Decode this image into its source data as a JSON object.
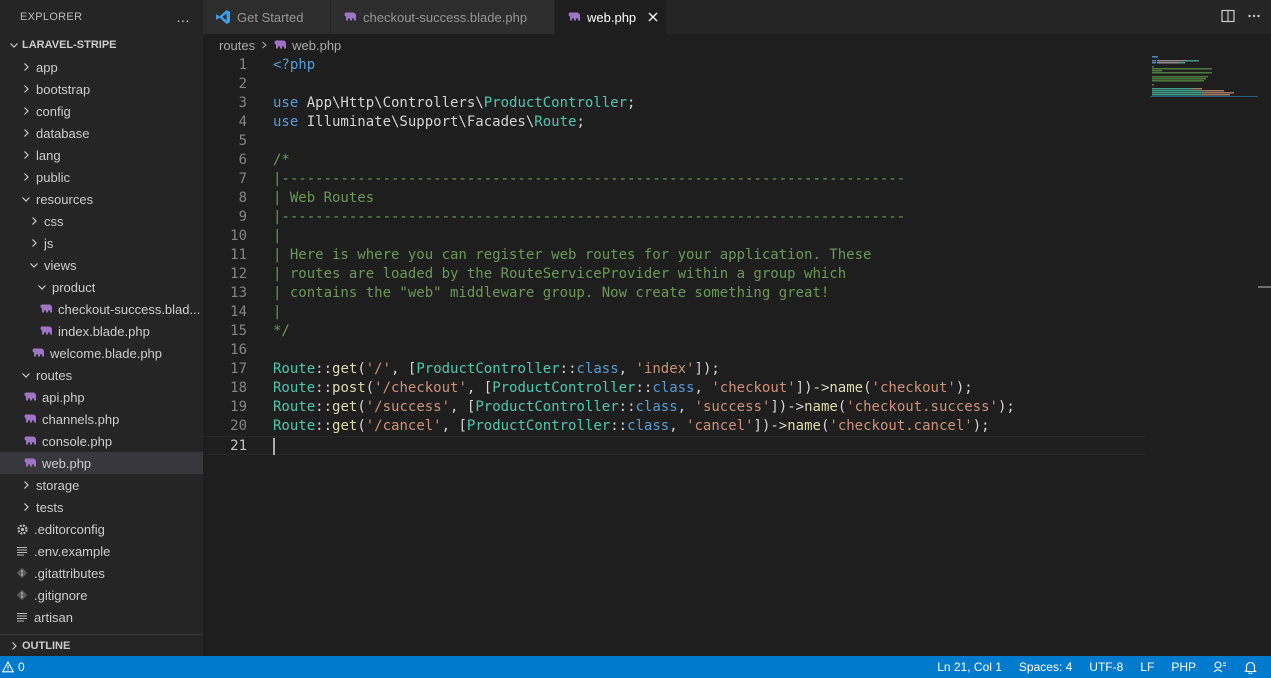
{
  "sidebar": {
    "title": "EXPLORER",
    "more_icon": "…",
    "project": "LARAVEL-STRIPE",
    "items": [
      {
        "label": "app",
        "level": 0,
        "type": "folder",
        "state": "collapsed"
      },
      {
        "label": "bootstrap",
        "level": 0,
        "type": "folder",
        "state": "collapsed"
      },
      {
        "label": "config",
        "level": 0,
        "type": "folder",
        "state": "collapsed"
      },
      {
        "label": "database",
        "level": 0,
        "type": "folder",
        "state": "collapsed"
      },
      {
        "label": "lang",
        "level": 0,
        "type": "folder",
        "state": "collapsed"
      },
      {
        "label": "public",
        "level": 0,
        "type": "folder",
        "state": "collapsed"
      },
      {
        "label": "resources",
        "level": 0,
        "type": "folder",
        "state": "expanded"
      },
      {
        "label": "css",
        "level": 1,
        "type": "folder",
        "state": "collapsed"
      },
      {
        "label": "js",
        "level": 1,
        "type": "folder",
        "state": "collapsed"
      },
      {
        "label": "views",
        "level": 1,
        "type": "folder",
        "state": "expanded"
      },
      {
        "label": "product",
        "level": 2,
        "type": "folder",
        "state": "expanded"
      },
      {
        "label": "checkout-success.blad...",
        "level": 3,
        "type": "php"
      },
      {
        "label": "index.blade.php",
        "level": 3,
        "type": "php"
      },
      {
        "label": "welcome.blade.php",
        "level": 2,
        "type": "php"
      },
      {
        "label": "routes",
        "level": 0,
        "type": "folder",
        "state": "expanded"
      },
      {
        "label": "api.php",
        "level": 1,
        "type": "php"
      },
      {
        "label": "channels.php",
        "level": 1,
        "type": "php"
      },
      {
        "label": "console.php",
        "level": 1,
        "type": "php"
      },
      {
        "label": "web.php",
        "level": 1,
        "type": "php",
        "selected": true
      },
      {
        "label": "storage",
        "level": 0,
        "type": "folder",
        "state": "collapsed"
      },
      {
        "label": "tests",
        "level": 0,
        "type": "folder",
        "state": "collapsed"
      },
      {
        "label": ".editorconfig",
        "level": 0,
        "type": "gear"
      },
      {
        "label": ".env.example",
        "level": 0,
        "type": "lines"
      },
      {
        "label": ".gitattributes",
        "level": 0,
        "type": "git"
      },
      {
        "label": ".gitignore",
        "level": 0,
        "type": "git"
      },
      {
        "label": "artisan",
        "level": 0,
        "type": "lines"
      }
    ],
    "outline": "OUTLINE"
  },
  "tabs": [
    {
      "label": "Get Started",
      "icon": "vscode-icon",
      "active": false
    },
    {
      "label": "checkout-success.blade.php",
      "icon": "php-icon",
      "active": false
    },
    {
      "label": "web.php",
      "icon": "php-icon",
      "active": true
    }
  ],
  "breadcrumb": {
    "folder": "routes",
    "file": "web.php"
  },
  "editor": {
    "current_line": 21,
    "lines": [
      [
        [
          "<?php",
          "kw"
        ]
      ],
      [],
      [
        [
          "use ",
          "kw"
        ],
        [
          "App\\Http\\Controllers\\",
          "ns"
        ],
        [
          "ProductController",
          "cls"
        ],
        [
          ";",
          "pun"
        ]
      ],
      [
        [
          "use ",
          "kw"
        ],
        [
          "Illuminate\\Support\\Facades\\",
          "ns"
        ],
        [
          "Route",
          "cls"
        ],
        [
          ";",
          "pun"
        ]
      ],
      [],
      [
        [
          "/*",
          "cm"
        ]
      ],
      [
        [
          "|--------------------------------------------------------------------------",
          "cm"
        ]
      ],
      [
        [
          "| Web Routes",
          "cm"
        ]
      ],
      [
        [
          "|--------------------------------------------------------------------------",
          "cm"
        ]
      ],
      [
        [
          "|",
          "cm"
        ]
      ],
      [
        [
          "| Here is where you can register web routes for your application. These",
          "cm"
        ]
      ],
      [
        [
          "| routes are loaded by the RouteServiceProvider within a group which",
          "cm"
        ]
      ],
      [
        [
          "| contains the \"web\" middleware group. Now create something great!",
          "cm"
        ]
      ],
      [
        [
          "|",
          "cm"
        ]
      ],
      [
        [
          "*/",
          "cm"
        ]
      ],
      [],
      [
        [
          "Route",
          "cls"
        ],
        [
          "::",
          "pun"
        ],
        [
          "get",
          "fn"
        ],
        [
          "(",
          "pun"
        ],
        [
          "'/'",
          "str"
        ],
        [
          ", [",
          "pun"
        ],
        [
          "ProductController",
          "cls"
        ],
        [
          "::",
          "pun"
        ],
        [
          "class",
          "kw"
        ],
        [
          ", ",
          "pun"
        ],
        [
          "'index'",
          "str"
        ],
        [
          "]);",
          "pun"
        ]
      ],
      [
        [
          "Route",
          "cls"
        ],
        [
          "::",
          "pun"
        ],
        [
          "post",
          "fn"
        ],
        [
          "(",
          "pun"
        ],
        [
          "'/checkout'",
          "str"
        ],
        [
          ", [",
          "pun"
        ],
        [
          "ProductController",
          "cls"
        ],
        [
          "::",
          "pun"
        ],
        [
          "class",
          "kw"
        ],
        [
          ", ",
          "pun"
        ],
        [
          "'checkout'",
          "str"
        ],
        [
          "])->",
          "pun"
        ],
        [
          "name",
          "fn"
        ],
        [
          "(",
          "pun"
        ],
        [
          "'checkout'",
          "str"
        ],
        [
          ");",
          "pun"
        ]
      ],
      [
        [
          "Route",
          "cls"
        ],
        [
          "::",
          "pun"
        ],
        [
          "get",
          "fn"
        ],
        [
          "(",
          "pun"
        ],
        [
          "'/success'",
          "str"
        ],
        [
          ", [",
          "pun"
        ],
        [
          "ProductController",
          "cls"
        ],
        [
          "::",
          "pun"
        ],
        [
          "class",
          "kw"
        ],
        [
          ", ",
          "pun"
        ],
        [
          "'success'",
          "str"
        ],
        [
          "])->",
          "pun"
        ],
        [
          "name",
          "fn"
        ],
        [
          "(",
          "pun"
        ],
        [
          "'checkout.success'",
          "str"
        ],
        [
          ");",
          "pun"
        ]
      ],
      [
        [
          "Route",
          "cls"
        ],
        [
          "::",
          "pun"
        ],
        [
          "get",
          "fn"
        ],
        [
          "(",
          "pun"
        ],
        [
          "'/cancel'",
          "str"
        ],
        [
          ", [",
          "pun"
        ],
        [
          "ProductController",
          "cls"
        ],
        [
          "::",
          "pun"
        ],
        [
          "class",
          "kw"
        ],
        [
          ", ",
          "pun"
        ],
        [
          "'cancel'",
          "str"
        ],
        [
          "])->",
          "pun"
        ],
        [
          "name",
          "fn"
        ],
        [
          "(",
          "pun"
        ],
        [
          "'checkout.cancel'",
          "str"
        ],
        [
          ");",
          "pun"
        ]
      ],
      []
    ]
  },
  "statusbar": {
    "problems_count": "0",
    "position": "Ln 21, Col 1",
    "spaces": "Spaces: 4",
    "encoding": "UTF-8",
    "eol": "LF",
    "language": "PHP"
  },
  "colors": {
    "accent": "#007acc",
    "php_icon": "#a074c4",
    "vscode_blue": "#3b9de8"
  }
}
